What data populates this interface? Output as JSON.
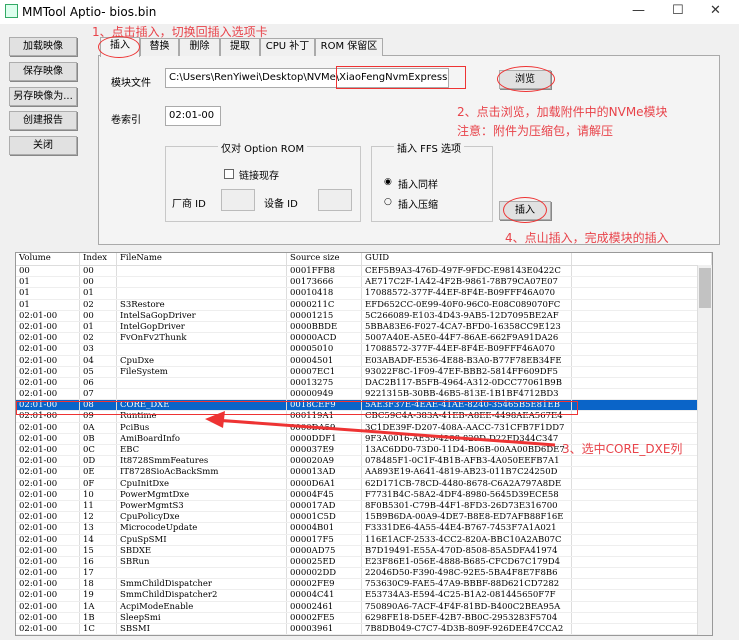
{
  "window": {
    "title": "MMTool Aptio- bios.bin",
    "minimize": "—",
    "maximize": "☐",
    "close": "✕"
  },
  "sidebar": {
    "buttons": [
      "加载映像",
      "保存映像",
      "另存映像为...",
      "创建报告",
      "关闭"
    ]
  },
  "tabs": [
    "插入",
    "替换",
    "删除",
    "提取",
    "CPU 补丁",
    "ROM 保留区"
  ],
  "insert": {
    "module_file_label": "模块文件",
    "module_file_value": "C:\\Users\\RenYiwei\\Desktop\\NVMe\\XiaoFengNvmExpressDxe.ffs",
    "browse": "浏览",
    "volume_index_label": "卷索引",
    "volume_index_value": "02:01-00",
    "option_rom_group": "仅对 Option ROM",
    "link_present": "链接现存",
    "vendor_id": "厂商 ID",
    "device_id": "设备 ID",
    "ffs_group": "插入 FFS 选项",
    "insert_as_is": "插入同样",
    "insert_compressed": "插入压缩",
    "insert_button": "插入"
  },
  "annotations": {
    "a1": "1、点击插入，切换回插入选项卡",
    "a2": "2、点击浏览，加载附件中的NVMe模块",
    "a2b": "注意：附件为压缩包，请解压",
    "a3": "3、选中CORE_DXE列",
    "a4": "4、点山插入，完成模块的插入"
  },
  "colors": {
    "annotation": "#e8434a",
    "selection": "#0a64c8"
  },
  "table": {
    "columns": [
      "Volume",
      "Index",
      "FileName",
      "Source size",
      "GUID"
    ],
    "selected_index": 12,
    "rows": [
      [
        "00",
        "00",
        "",
        "0001FFB8",
        "CEF5B9A3-476D-497F-9FDC-E98143E0422C"
      ],
      [
        "01",
        "00",
        "",
        "00173666",
        "AE717C2F-1A42-4F2B-9861-78B79CA07E07"
      ],
      [
        "01",
        "01",
        "",
        "00010418",
        "17088572-377F-44EF-8F4E-B09FFF46A070"
      ],
      [
        "01",
        "02",
        "S3Restore",
        "0000211C",
        "EFD652CC-0E99-40F0-96C0-E08C089070FC"
      ],
      [
        "02:01-00",
        "00",
        "IntelSaGopDriver",
        "00001215",
        "5C266089-E103-4D43-9AB5-12D7095BE2AF"
      ],
      [
        "02:01-00",
        "01",
        "IntelGopDriver",
        "0000BBDE",
        "5BBA83E6-F027-4CA7-BFD0-16358CC9E123"
      ],
      [
        "02:01-00",
        "02",
        "FvOnFv2Thunk",
        "00000ACD",
        "5007A40E-A5E0-44F7-86AE-662F9A91DA26"
      ],
      [
        "02:01-00",
        "03",
        "",
        "00005010",
        "17088572-377F-44EF-8F4E-B09FFF46A070"
      ],
      [
        "02:01-00",
        "04",
        "CpuDxe",
        "00004501",
        "E03ABADF-E536-4E88-B3A0-B77F78EB34FE"
      ],
      [
        "02:01-00",
        "05",
        "FileSystem",
        "00007EC1",
        "93022F8C-1F09-47EF-BBB2-5814FF609DF5"
      ],
      [
        "02:01-00",
        "06",
        "",
        "00013275",
        "DAC2B117-B5FB-4964-A312-0DCC77061B9B"
      ],
      [
        "02:01-00",
        "07",
        "",
        "00000949",
        "9221315B-30BB-46B5-813E-1B1BF4712BD3"
      ],
      [
        "02:01-00",
        "08",
        "CORE_DXE",
        "0018CEF9",
        "5AE3F37E-4EAE-41AE-8240-35465B5E81EB"
      ],
      [
        "02:01-00",
        "09",
        "Runtime",
        "000119A1",
        "CBC59C4A-383A-41EB-A8EE-4498AEA567E4"
      ],
      [
        "02:01-00",
        "0A",
        "PciBus",
        "0000DA59",
        "3C1DE39F-D207-408A-AACC-731CFB7F1DD7"
      ],
      [
        "02:01-00",
        "0B",
        "AmiBoardInfo",
        "0000DDF1",
        "9F3A0016-AE55-4288-829D-D22FD344C347"
      ],
      [
        "02:01-00",
        "0C",
        "EBC",
        "000037E9",
        "13AC6DD0-73D0-11D4-B06B-00AA00BD6DE7"
      ],
      [
        "02:01-00",
        "0D",
        "It8728SmmFeatures",
        "000020A9",
        "078485F1-0C1F-4B1B-AFB3-4A050EEFB7A1"
      ],
      [
        "02:01-00",
        "0E",
        "IT8728SioAcBackSmm",
        "000013AD",
        "AA893E19-A641-4819-AB23-011B7C24250D"
      ],
      [
        "02:01-00",
        "0F",
        "CpuInitDxe",
        "0000D6A1",
        "62D171CB-78CD-4480-8678-C6A2A797A8DE"
      ],
      [
        "02:01-00",
        "10",
        "PowerMgmtDxe",
        "00004F45",
        "F7731B4C-58A2-4DF4-8980-5645D39ECE58"
      ],
      [
        "02:01-00",
        "11",
        "PowerMgmtS3",
        "000017AD",
        "8F0B5301-C79B-44F1-8FD3-26D73E316700"
      ],
      [
        "02:01-00",
        "12",
        "CpuPolicyDxe",
        "00001C5D",
        "15B9B6DA-00A9-4DE7-B8E8-ED7AFB88F16E"
      ],
      [
        "02:01-00",
        "13",
        "MicrocodeUpdate",
        "00004B01",
        "F3331DE6-4A55-44E4-B767-7453F7A1A021"
      ],
      [
        "02:01-00",
        "14",
        "CpuSpSMI",
        "000017F5",
        "116E1ACF-2533-4CC2-820A-BBC10A2AB07C"
      ],
      [
        "02:01-00",
        "15",
        "SBDXE",
        "0000AD75",
        "B7D19491-E55A-470D-8508-85A5DFA41974"
      ],
      [
        "02:01-00",
        "16",
        "SBRun",
        "000025ED",
        "E23F86E1-056E-4888-B685-CFCD67C179D4"
      ],
      [
        "02:01-00",
        "17",
        "",
        "000002DD",
        "22046D50-F390-498C-92E5-5BA4F8E7F8B6"
      ],
      [
        "02:01-00",
        "18",
        "SmmChildDispatcher",
        "00002FE9",
        "753630C9-FAE5-47A9-BBBF-88D621CD7282"
      ],
      [
        "02:01-00",
        "19",
        "SmmChildDispatcher2",
        "00004C41",
        "E53734A3-E594-4C25-B1A2-081445650F7F"
      ],
      [
        "02:01-00",
        "1A",
        "AcpiModeEnable",
        "00002461",
        "750890A6-7ACF-4F4F-81BD-B400C2BEA95A"
      ],
      [
        "02:01-00",
        "1B",
        "SleepSmi",
        "00002FE5",
        "6298FE18-D5EF-42B7-BB0C-2953283F5704"
      ],
      [
        "02:01-00",
        "1C",
        "SBSMI",
        "00003961",
        "7B8DB049-C7C7-4D3B-809F-926DEE47CCA2"
      ]
    ]
  }
}
